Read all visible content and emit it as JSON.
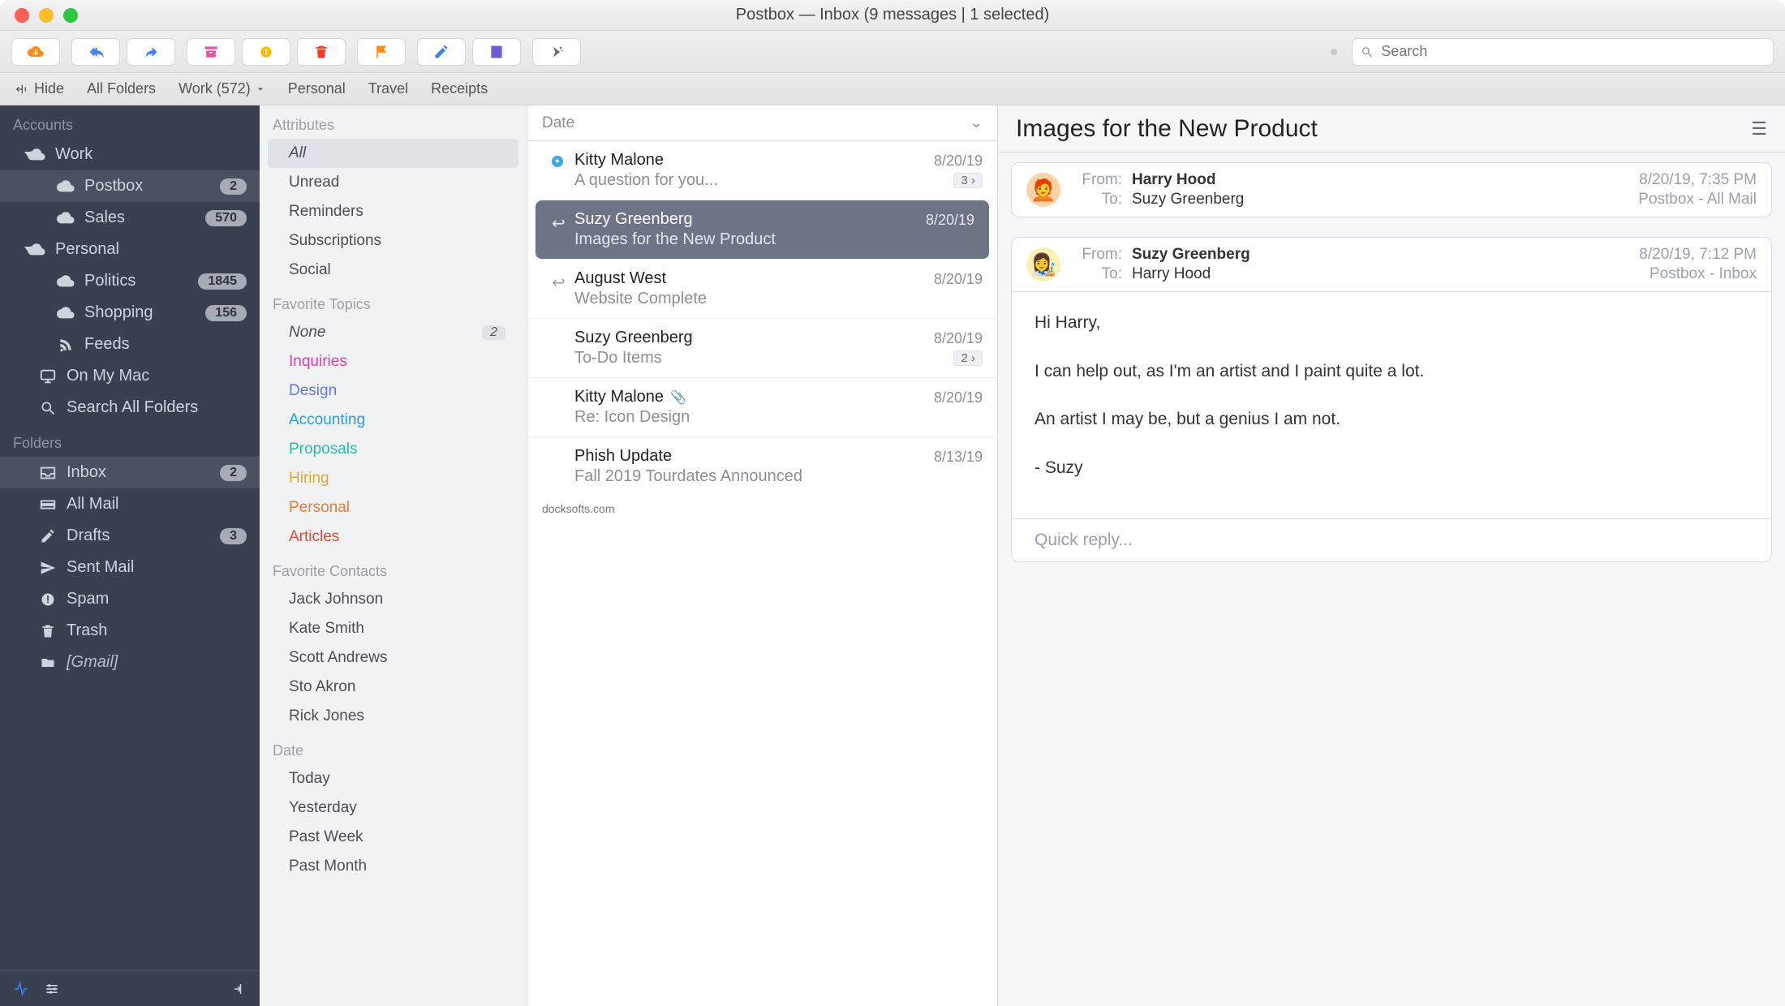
{
  "window": {
    "title": "Postbox — Inbox (9 messages | 1 selected)"
  },
  "toolbar": {},
  "search": {
    "placeholder": "Search"
  },
  "favorites_bar": {
    "hide": "Hide",
    "items": [
      "All Folders",
      "Work (572)",
      "Personal",
      "Travel",
      "Receipts"
    ]
  },
  "sidebar": {
    "sections": {
      "accounts_title": "Accounts",
      "folders_title": "Folders"
    },
    "accounts": [
      {
        "name": "Work",
        "children": [
          {
            "name": "Postbox",
            "badge": "2",
            "selected": true
          },
          {
            "name": "Sales",
            "badge": "570"
          }
        ]
      },
      {
        "name": "Personal",
        "children": [
          {
            "name": "Politics",
            "badge": "1845"
          },
          {
            "name": "Shopping",
            "badge": "156"
          },
          {
            "name": "Feeds"
          }
        ]
      }
    ],
    "on_my_mac": "On My Mac",
    "search_all": "Search All Folders",
    "folders": [
      {
        "name": "Inbox",
        "badge": "2",
        "selected": true
      },
      {
        "name": "All Mail"
      },
      {
        "name": "Drafts",
        "badge": "3"
      },
      {
        "name": "Sent Mail"
      },
      {
        "name": "Spam"
      },
      {
        "name": "Trash"
      },
      {
        "name": "[Gmail]",
        "italic": true
      }
    ]
  },
  "attributes": {
    "attributes_title": "Attributes",
    "items": [
      {
        "label": "All",
        "selected": true
      },
      {
        "label": "Unread"
      },
      {
        "label": "Reminders"
      },
      {
        "label": "Subscriptions"
      },
      {
        "label": "Social"
      }
    ],
    "topics_title": "Favorite Topics",
    "topics": [
      {
        "label": "None",
        "badge": "2",
        "none": true
      },
      {
        "label": "Inquiries"
      },
      {
        "label": "Design"
      },
      {
        "label": "Accounting"
      },
      {
        "label": "Proposals"
      },
      {
        "label": "Hiring"
      },
      {
        "label": "Personal"
      },
      {
        "label": "Articles"
      }
    ],
    "contacts_title": "Favorite Contacts",
    "contacts": [
      "Jack Johnson",
      "Kate Smith",
      "Scott Andrews",
      "Sto Akron",
      "Rick Jones"
    ],
    "date_title": "Date",
    "dates": [
      "Today",
      "Yesterday",
      "Past Week",
      "Past Month"
    ]
  },
  "message_list": {
    "sort_label": "Date",
    "messages": [
      {
        "from": "Kitty Malone",
        "subject": "A question for you...",
        "date": "8/20/19",
        "status": "dot",
        "count": "3"
      },
      {
        "from": "Suzy Greenberg",
        "subject": "Images for the New Product",
        "date": "8/20/19",
        "reply": true,
        "selected": true
      },
      {
        "from": "August West",
        "subject": "Website Complete",
        "date": "8/20/19",
        "reply": true
      },
      {
        "from": "Suzy Greenberg",
        "subject": "To-Do Items",
        "date": "8/20/19",
        "count": "2"
      },
      {
        "from": "Kitty Malone",
        "subject": "Re: Icon Design",
        "date": "8/20/19",
        "attachment": true
      },
      {
        "from": "Phish Update",
        "subject": "Fall 2019 Tourdates Announced",
        "date": "8/13/19"
      }
    ],
    "watermark": "docksofts.com"
  },
  "reader": {
    "subject": "Images for the New Product",
    "thread": [
      {
        "from_label": "From:",
        "from": "Harry Hood",
        "to_label": "To:",
        "to": "Suzy Greenberg",
        "date": "8/20/19, 7:35 PM",
        "mailbox": "Postbox - All Mail",
        "avatar": "harry",
        "collapsed": true
      },
      {
        "from_label": "From:",
        "from": "Suzy Greenberg",
        "to_label": "To:",
        "to": "Harry Hood",
        "date": "8/20/19, 7:12 PM",
        "mailbox": "Postbox - Inbox",
        "avatar": "suzy",
        "body": [
          "Hi Harry,",
          "I can help out, as I'm an artist and I paint quite a lot.",
          "An artist I may be, but a genius I am not.",
          "- Suzy"
        ]
      }
    ],
    "quick_reply_placeholder": "Quick reply..."
  }
}
